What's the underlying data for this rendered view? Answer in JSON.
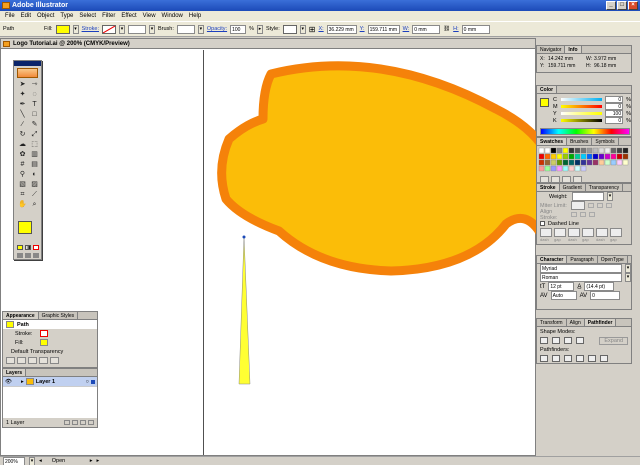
{
  "window": {
    "title": "Adobe Illustrator"
  },
  "menubar": {
    "items": [
      "File",
      "Edit",
      "Object",
      "Type",
      "Select",
      "Filter",
      "Effect",
      "View",
      "Window",
      "Help"
    ]
  },
  "controlbar": {
    "object_type": "Path",
    "fill_label": "Fill:",
    "stroke_label": "Stroke:",
    "brush_label": "Brush:",
    "opacity_label": "Opacity:",
    "opacity_value": "100",
    "opacity_unit": "%",
    "style_label": "Style:",
    "x_label": "X:",
    "x_value": "36.229 mm",
    "y_label": "Y:",
    "y_value": "159.711 mm",
    "w_label": "W:",
    "w_value": "0 mm",
    "h_label": "H:",
    "h_value": "0 mm",
    "fill_color": "#ffff00"
  },
  "document": {
    "title": "Logo Tutorial.ai @ 200% (CMYK/Preview)"
  },
  "status": {
    "zoom": "200%",
    "state": "Open"
  },
  "artwork": {
    "lemon_fill": "#fbbd08",
    "lemon_stroke": "#f5820a",
    "shape_fill": "#ffff33"
  },
  "navinfo": {
    "tabs": [
      "Navigator",
      "Info"
    ],
    "x_label": "X:",
    "x_value": "14.242 mm",
    "y_label": "Y:",
    "y_value": "159.711 mm",
    "w_label": "W:",
    "w_value": "3.972 mm",
    "h_label": "H:",
    "h_value": "96.18 mm"
  },
  "color_panel": {
    "title": "Color",
    "channels": [
      {
        "label": "C",
        "value": "0",
        "pct": "%"
      },
      {
        "label": "M",
        "value": "0",
        "pct": "%"
      },
      {
        "label": "Y",
        "value": "100",
        "pct": "%"
      },
      {
        "label": "K",
        "value": "0",
        "pct": "%"
      }
    ]
  },
  "swatches_panel": {
    "tabs": [
      "Swatches",
      "Brushes",
      "Symbols"
    ]
  },
  "stroke_panel": {
    "tabs": [
      "Stroke",
      "Gradient",
      "Transparency"
    ],
    "weight_label": "Weight:",
    "miter_label": "Miter Limit:",
    "align_label": "Align Stroke:",
    "dashed_label": "Dashed Line",
    "dash_labels": [
      "dash",
      "gap",
      "dash",
      "gap",
      "dash",
      "gap"
    ]
  },
  "character_panel": {
    "tabs": [
      "Character",
      "Paragraph",
      "OpenType"
    ],
    "font": "Myriad",
    "style": "Roman",
    "size": "12 pt",
    "leading": "(14.4 pt)",
    "kerning": "Auto",
    "tracking": "0"
  },
  "pathfinder_panel": {
    "tabs": [
      "Transform",
      "Align",
      "Pathfinder"
    ],
    "shape_modes_label": "Shape Modes:",
    "expand_label": "Expand",
    "pathfinders_label": "Pathfinders:"
  },
  "appearance_panel": {
    "tabs": [
      "Appearance",
      "Graphic Styles"
    ],
    "object": "Path",
    "stroke_label": "Stroke:",
    "fill_label": "Fill:",
    "transparency": "Default Transparency"
  },
  "layers_panel": {
    "title": "Layers",
    "layer_name": "Layer 1",
    "count": "1 Layer"
  }
}
